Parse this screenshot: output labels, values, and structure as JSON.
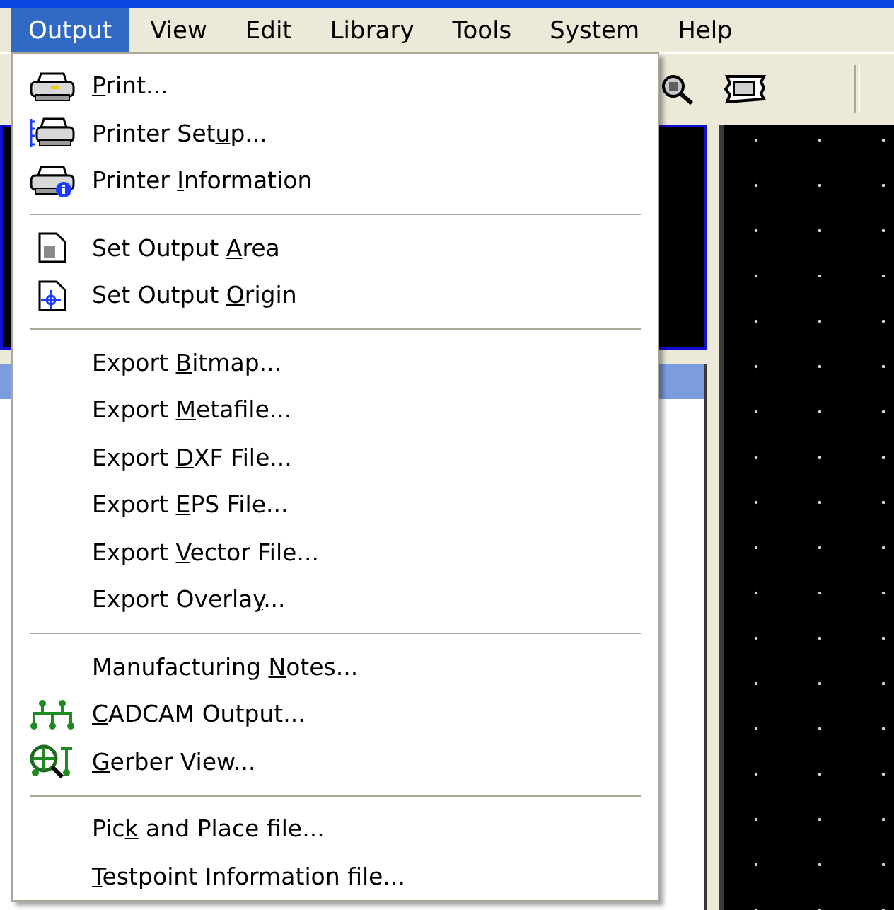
{
  "menubar": [
    {
      "label": "Output",
      "selected": true
    },
    {
      "label": "View",
      "selected": false
    },
    {
      "label": "Edit",
      "selected": false
    },
    {
      "label": "Library",
      "selected": false
    },
    {
      "label": "Tools",
      "selected": false
    },
    {
      "label": "System",
      "selected": false
    },
    {
      "label": "Help",
      "selected": false
    }
  ],
  "menu": {
    "items": [
      {
        "kind": "printer",
        "label": {
          "key": "P",
          "after": "rint..."
        }
      },
      {
        "kind": "printer-setup",
        "label": {
          "before": "Printer Set",
          "key": "u",
          "after": "p..."
        }
      },
      {
        "kind": "printer-info",
        "label": {
          "before": "Printer ",
          "key": "I",
          "after": "nformation"
        }
      },
      {
        "kind": "separator"
      },
      {
        "kind": "area",
        "label": {
          "before": "Set Output ",
          "key": "A",
          "after": "rea"
        }
      },
      {
        "kind": "origin",
        "label": {
          "before": "Set Output ",
          "key": "O",
          "after": "rigin"
        }
      },
      {
        "kind": "separator"
      },
      {
        "kind": "plain",
        "label": {
          "before": "Export ",
          "key": "B",
          "after": "itmap..."
        }
      },
      {
        "kind": "plain",
        "label": {
          "before": "Export ",
          "key": "M",
          "after": "etafile..."
        }
      },
      {
        "kind": "plain",
        "label": {
          "before": "Export ",
          "key": "D",
          "after": "XF File..."
        }
      },
      {
        "kind": "plain",
        "label": {
          "before": "Export ",
          "key": "E",
          "after": "PS File..."
        }
      },
      {
        "kind": "plain",
        "label": {
          "before": "Export ",
          "key": "V",
          "after": "ector File..."
        }
      },
      {
        "kind": "plain",
        "label": {
          "before": "Export Overla",
          "key": "y",
          "after": "..."
        }
      },
      {
        "kind": "separator"
      },
      {
        "kind": "plain",
        "label": {
          "before": "Manufacturing ",
          "key": "N",
          "after": "otes..."
        }
      },
      {
        "kind": "cadcam",
        "label": {
          "key": "C",
          "after": "ADCAM Output..."
        }
      },
      {
        "kind": "gerber",
        "label": {
          "key": "G",
          "after": "erber View..."
        }
      },
      {
        "kind": "separator"
      },
      {
        "kind": "plain",
        "label": {
          "before": "Pic",
          "key": "k",
          "after": " and Place file..."
        }
      },
      {
        "kind": "plain",
        "label": {
          "key": "T",
          "after": "estpoint Information file..."
        }
      }
    ]
  }
}
